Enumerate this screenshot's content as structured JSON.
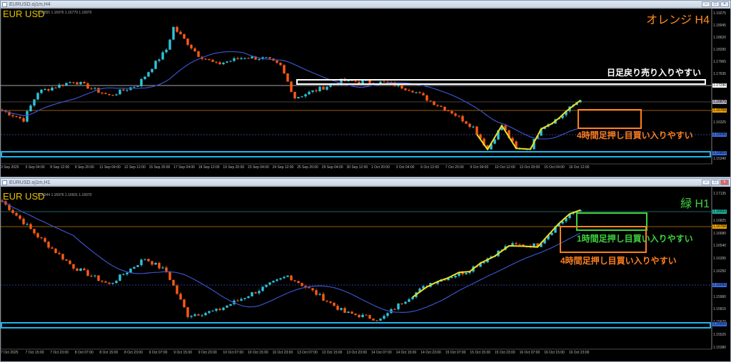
{
  "colors": {
    "bull": "#2ec4dc",
    "bear": "#ff5a14",
    "ma": "#3a52c8",
    "zig": "#f0e020",
    "orange": "#ff7f1e",
    "green": "#3ed23e",
    "cyan": "#1eb4f0"
  },
  "top": {
    "window_title": "EURUSD.oj1m,H4",
    "symbol": "EUR USD",
    "ohlc": "1.16855 1.16976 1.16779 1.16970",
    "timeframe_label": "オレンジ H4",
    "annotations": {
      "sell": "日足戻り売り入りやすい",
      "buy4h": "4時間足押し目買い入りやすい"
    },
    "price_labels": [
      "1.19275",
      "1.18945",
      "1.18620",
      "1.18290",
      "1.17965",
      "1.17635",
      "1.17310",
      "1.16655",
      "1.16325",
      "1.16000",
      "1.15340"
    ],
    "price_tags": {
      "white": "1.17296",
      "gray": "1.16879",
      "orange": "1.16768",
      "blue": "1.16096",
      "box": "1.15853"
    },
    "time_labels": [
      "3 Sep 2025",
      "5 Sep 04:00",
      "8 Sep 12:00",
      "9 Sep 20:00",
      "11 Sep 04:00",
      "12 Sep 12:00",
      "15 Sep 20:00",
      "17 Sep 04:00",
      "18 Sep 12:00",
      "19 Sep 20:00",
      "23 Sep 04:00",
      "24 Sep 12:00",
      "25 Sep 20:00",
      "29 Sep 04:00",
      "30 Sep 12:00",
      "1 Oct 20:00",
      "3 Oct 04:00",
      "6 Oct 12:00",
      "7 Oct 20:00",
      "9 Oct 04:00",
      "10 Oct 12:00",
      "13 Oct 20:00",
      "15 Oct 04:00",
      "16 Oct 12:00"
    ],
    "chart_data": {
      "type": "candlestick",
      "price_range": [
        1.1534,
        1.19275
      ],
      "keypoints": [
        [
          0,
          1.1665
        ],
        [
          6,
          1.164
        ],
        [
          10,
          1.1715
        ],
        [
          20,
          1.1745
        ],
        [
          30,
          1.1705
        ],
        [
          38,
          1.1735
        ],
        [
          46,
          1.183
        ],
        [
          48,
          1.189
        ],
        [
          55,
          1.1815
        ],
        [
          60,
          1.179
        ],
        [
          68,
          1.181
        ],
        [
          74,
          1.1805
        ],
        [
          78,
          1.1785
        ],
        [
          82,
          1.17
        ],
        [
          88,
          1.172
        ],
        [
          95,
          1.1745
        ],
        [
          108,
          1.174
        ],
        [
          115,
          1.172
        ],
        [
          120,
          1.169
        ],
        [
          126,
          1.166
        ],
        [
          132,
          1.162
        ],
        [
          136,
          1.156
        ],
        [
          140,
          1.1625
        ],
        [
          144,
          1.156
        ],
        [
          148,
          1.1565
        ],
        [
          151,
          1.162
        ],
        [
          156,
          1.1645
        ],
        [
          162,
          1.1697
        ]
      ]
    }
  },
  "bottom": {
    "window_title": "EURUSD.oj1m,H1",
    "symbol": "EUR USD",
    "ohlc": "1.16944 1.16976 1.16931 1.16970",
    "timeframe_label": "緑 H1",
    "annotations": {
      "buy1h": "1時間足押し目買い入りやすい",
      "buy4h": "4時間足押し目買い入りやすい"
    },
    "price_labels": [
      "1.17135",
      "1.16825",
      "1.16680",
      "1.16540",
      "1.16395",
      "1.16250",
      "1.15960",
      "1.15815",
      "1.15670",
      "1.15525",
      "1.15380"
    ],
    "price_tags": {
      "teal": "1.16933",
      "orange": "1.16768",
      "blue": "1.16096",
      "box": "1.15692"
    },
    "time_labels": [
      "7 Oct 2025",
      "7 Oct 15:00",
      "7 Oct 23:00",
      "8 Oct 07:00",
      "8 Oct 15:00",
      "8 Oct 23:00",
      "9 Oct 07:00",
      "9 Oct 15:00",
      "9 Oct 23:00",
      "10 Oct 07:00",
      "10 Oct 15:00",
      "10 Oct 23:00",
      "13 Oct 07:00",
      "13 Oct 15:00",
      "13 Oct 23:00",
      "14 Oct 07:00",
      "14 Oct 15:00",
      "14 Oct 23:00",
      "15 Oct 07:00",
      "15 Oct 15:00",
      "15 Oct 23:00",
      "16 Oct 07:00",
      "16 Oct 15:00",
      "16 Oct 23:00"
    ],
    "chart_data": {
      "type": "candlestick",
      "price_range": [
        1.1538,
        1.17135
      ],
      "keypoints": [
        [
          0,
          1.1705
        ],
        [
          10,
          1.1665
        ],
        [
          20,
          1.163
        ],
        [
          30,
          1.161
        ],
        [
          40,
          1.164
        ],
        [
          46,
          1.1625
        ],
        [
          52,
          1.1575
        ],
        [
          60,
          1.158
        ],
        [
          70,
          1.16
        ],
        [
          80,
          1.162
        ],
        [
          86,
          1.1605
        ],
        [
          96,
          1.1578
        ],
        [
          106,
          1.157
        ],
        [
          112,
          1.159
        ],
        [
          120,
          1.1612
        ],
        [
          130,
          1.1625
        ],
        [
          142,
          1.1655
        ],
        [
          150,
          1.1655
        ],
        [
          156,
          1.168
        ],
        [
          162,
          1.1697
        ]
      ]
    }
  }
}
